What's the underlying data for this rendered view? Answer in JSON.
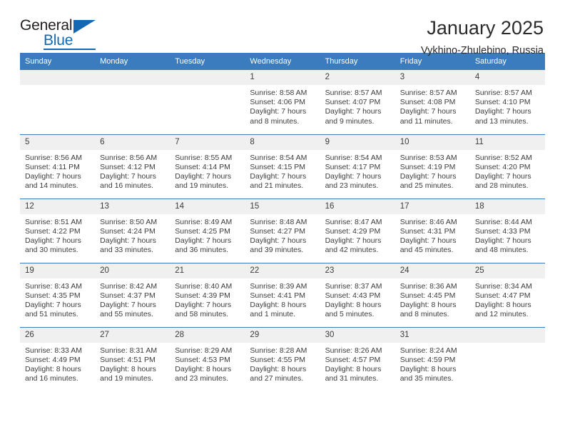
{
  "logo": {
    "word_one": "General",
    "word_two": "Blue",
    "triangle_icon": "blue-triangle-icon"
  },
  "header": {
    "month_title": "January 2025",
    "location": "Vykhino-Zhulebino, Russia"
  },
  "calendar": {
    "weekdays": [
      "Sunday",
      "Monday",
      "Tuesday",
      "Wednesday",
      "Thursday",
      "Friday",
      "Saturday"
    ],
    "header_color": "#3a7cbe",
    "daynum_background": "#f0f0f0",
    "weeks": [
      [
        {
          "day": "",
          "empty": true
        },
        {
          "day": "",
          "empty": true
        },
        {
          "day": "",
          "empty": true
        },
        {
          "day": "1",
          "sunrise": "Sunrise: 8:58 AM",
          "sunset": "Sunset: 4:06 PM",
          "daylight_line1": "Daylight: 7 hours",
          "daylight_line2": "and 8 minutes."
        },
        {
          "day": "2",
          "sunrise": "Sunrise: 8:57 AM",
          "sunset": "Sunset: 4:07 PM",
          "daylight_line1": "Daylight: 7 hours",
          "daylight_line2": "and 9 minutes."
        },
        {
          "day": "3",
          "sunrise": "Sunrise: 8:57 AM",
          "sunset": "Sunset: 4:08 PM",
          "daylight_line1": "Daylight: 7 hours",
          "daylight_line2": "and 11 minutes."
        },
        {
          "day": "4",
          "sunrise": "Sunrise: 8:57 AM",
          "sunset": "Sunset: 4:10 PM",
          "daylight_line1": "Daylight: 7 hours",
          "daylight_line2": "and 13 minutes."
        }
      ],
      [
        {
          "day": "5",
          "sunrise": "Sunrise: 8:56 AM",
          "sunset": "Sunset: 4:11 PM",
          "daylight_line1": "Daylight: 7 hours",
          "daylight_line2": "and 14 minutes."
        },
        {
          "day": "6",
          "sunrise": "Sunrise: 8:56 AM",
          "sunset": "Sunset: 4:12 PM",
          "daylight_line1": "Daylight: 7 hours",
          "daylight_line2": "and 16 minutes."
        },
        {
          "day": "7",
          "sunrise": "Sunrise: 8:55 AM",
          "sunset": "Sunset: 4:14 PM",
          "daylight_line1": "Daylight: 7 hours",
          "daylight_line2": "and 19 minutes."
        },
        {
          "day": "8",
          "sunrise": "Sunrise: 8:54 AM",
          "sunset": "Sunset: 4:15 PM",
          "daylight_line1": "Daylight: 7 hours",
          "daylight_line2": "and 21 minutes."
        },
        {
          "day": "9",
          "sunrise": "Sunrise: 8:54 AM",
          "sunset": "Sunset: 4:17 PM",
          "daylight_line1": "Daylight: 7 hours",
          "daylight_line2": "and 23 minutes."
        },
        {
          "day": "10",
          "sunrise": "Sunrise: 8:53 AM",
          "sunset": "Sunset: 4:19 PM",
          "daylight_line1": "Daylight: 7 hours",
          "daylight_line2": "and 25 minutes."
        },
        {
          "day": "11",
          "sunrise": "Sunrise: 8:52 AM",
          "sunset": "Sunset: 4:20 PM",
          "daylight_line1": "Daylight: 7 hours",
          "daylight_line2": "and 28 minutes."
        }
      ],
      [
        {
          "day": "12",
          "sunrise": "Sunrise: 8:51 AM",
          "sunset": "Sunset: 4:22 PM",
          "daylight_line1": "Daylight: 7 hours",
          "daylight_line2": "and 30 minutes."
        },
        {
          "day": "13",
          "sunrise": "Sunrise: 8:50 AM",
          "sunset": "Sunset: 4:24 PM",
          "daylight_line1": "Daylight: 7 hours",
          "daylight_line2": "and 33 minutes."
        },
        {
          "day": "14",
          "sunrise": "Sunrise: 8:49 AM",
          "sunset": "Sunset: 4:25 PM",
          "daylight_line1": "Daylight: 7 hours",
          "daylight_line2": "and 36 minutes."
        },
        {
          "day": "15",
          "sunrise": "Sunrise: 8:48 AM",
          "sunset": "Sunset: 4:27 PM",
          "daylight_line1": "Daylight: 7 hours",
          "daylight_line2": "and 39 minutes."
        },
        {
          "day": "16",
          "sunrise": "Sunrise: 8:47 AM",
          "sunset": "Sunset: 4:29 PM",
          "daylight_line1": "Daylight: 7 hours",
          "daylight_line2": "and 42 minutes."
        },
        {
          "day": "17",
          "sunrise": "Sunrise: 8:46 AM",
          "sunset": "Sunset: 4:31 PM",
          "daylight_line1": "Daylight: 7 hours",
          "daylight_line2": "and 45 minutes."
        },
        {
          "day": "18",
          "sunrise": "Sunrise: 8:44 AM",
          "sunset": "Sunset: 4:33 PM",
          "daylight_line1": "Daylight: 7 hours",
          "daylight_line2": "and 48 minutes."
        }
      ],
      [
        {
          "day": "19",
          "sunrise": "Sunrise: 8:43 AM",
          "sunset": "Sunset: 4:35 PM",
          "daylight_line1": "Daylight: 7 hours",
          "daylight_line2": "and 51 minutes."
        },
        {
          "day": "20",
          "sunrise": "Sunrise: 8:42 AM",
          "sunset": "Sunset: 4:37 PM",
          "daylight_line1": "Daylight: 7 hours",
          "daylight_line2": "and 55 minutes."
        },
        {
          "day": "21",
          "sunrise": "Sunrise: 8:40 AM",
          "sunset": "Sunset: 4:39 PM",
          "daylight_line1": "Daylight: 7 hours",
          "daylight_line2": "and 58 minutes."
        },
        {
          "day": "22",
          "sunrise": "Sunrise: 8:39 AM",
          "sunset": "Sunset: 4:41 PM",
          "daylight_line1": "Daylight: 8 hours",
          "daylight_line2": "and 1 minute."
        },
        {
          "day": "23",
          "sunrise": "Sunrise: 8:37 AM",
          "sunset": "Sunset: 4:43 PM",
          "daylight_line1": "Daylight: 8 hours",
          "daylight_line2": "and 5 minutes."
        },
        {
          "day": "24",
          "sunrise": "Sunrise: 8:36 AM",
          "sunset": "Sunset: 4:45 PM",
          "daylight_line1": "Daylight: 8 hours",
          "daylight_line2": "and 8 minutes."
        },
        {
          "day": "25",
          "sunrise": "Sunrise: 8:34 AM",
          "sunset": "Sunset: 4:47 PM",
          "daylight_line1": "Daylight: 8 hours",
          "daylight_line2": "and 12 minutes."
        }
      ],
      [
        {
          "day": "26",
          "sunrise": "Sunrise: 8:33 AM",
          "sunset": "Sunset: 4:49 PM",
          "daylight_line1": "Daylight: 8 hours",
          "daylight_line2": "and 16 minutes."
        },
        {
          "day": "27",
          "sunrise": "Sunrise: 8:31 AM",
          "sunset": "Sunset: 4:51 PM",
          "daylight_line1": "Daylight: 8 hours",
          "daylight_line2": "and 19 minutes."
        },
        {
          "day": "28",
          "sunrise": "Sunrise: 8:29 AM",
          "sunset": "Sunset: 4:53 PM",
          "daylight_line1": "Daylight: 8 hours",
          "daylight_line2": "and 23 minutes."
        },
        {
          "day": "29",
          "sunrise": "Sunrise: 8:28 AM",
          "sunset": "Sunset: 4:55 PM",
          "daylight_line1": "Daylight: 8 hours",
          "daylight_line2": "and 27 minutes."
        },
        {
          "day": "30",
          "sunrise": "Sunrise: 8:26 AM",
          "sunset": "Sunset: 4:57 PM",
          "daylight_line1": "Daylight: 8 hours",
          "daylight_line2": "and 31 minutes."
        },
        {
          "day": "31",
          "sunrise": "Sunrise: 8:24 AM",
          "sunset": "Sunset: 4:59 PM",
          "daylight_line1": "Daylight: 8 hours",
          "daylight_line2": "and 35 minutes."
        },
        {
          "day": "",
          "empty": true
        }
      ]
    ]
  }
}
